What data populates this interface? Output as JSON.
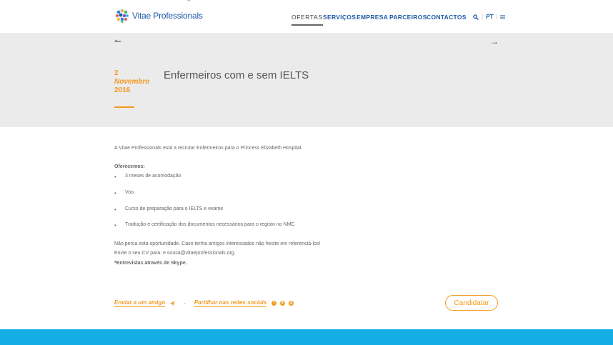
{
  "header": {
    "logo_text": "Vitae Professionals",
    "logo_reg": "®",
    "nav": [
      "OFERTAS",
      "SERVIÇOS",
      "EMPRESA",
      "PARCEIROS",
      "CONTACTOS"
    ],
    "lang": "PT",
    "icons": [
      "search-icon",
      "menu-icon"
    ]
  },
  "hero": {
    "prev_arrow": "↼",
    "next_arrow": "→",
    "date_day": "2",
    "date_month": "Novembro",
    "date_year": "2016",
    "title": "Enfermeiros com e sem IELTS"
  },
  "content": {
    "intro": "A Vitae Professionals está a recrutar Enfermeiros para o Princess Elizabeth Hospital.",
    "offer_heading": "Oferecemos:",
    "offers": [
      "3 meses de acomodação",
      "Voo",
      "Curso de preparação para o IELTS e exame",
      "Tradução e certificação dos documentos necessários para o registo no NMC"
    ],
    "para1": "Não perca esta oportunidade. Caso tenha amigos interessados não hesite em referenciá-los!",
    "para2": "Envie o seu CV para: e.sousa@vitaeprofessionals.org.",
    "para3": "*Entrevistas através de Skype."
  },
  "actions": {
    "send_friend": "Enviar a um amigo",
    "separator": "-",
    "share": "Partilhar nas redes sociais",
    "social_icons": [
      "facebook-icon",
      "linkedin-icon",
      "google-icon"
    ],
    "apply": "Candidatar"
  },
  "colors": {
    "accent": "#f39a1f",
    "brand": "#1f5aa6",
    "hero_bg": "#ebebeb",
    "footer": "#14aee5"
  }
}
